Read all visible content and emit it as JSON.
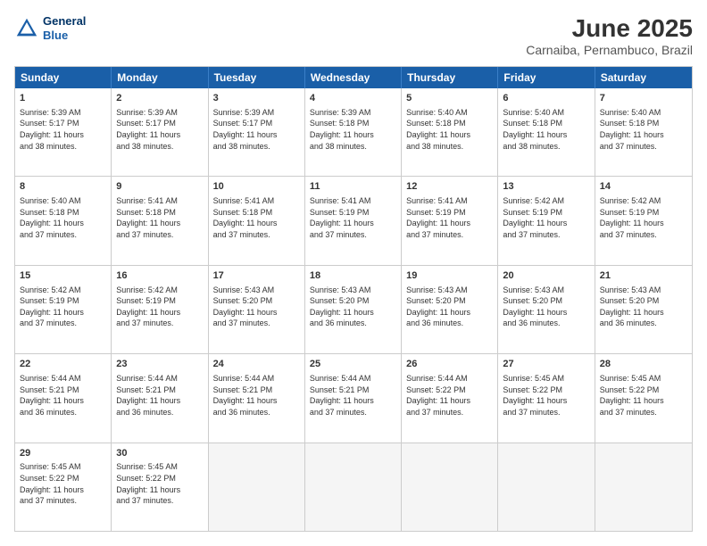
{
  "header": {
    "logo_line1": "General",
    "logo_line2": "Blue",
    "month_year": "June 2025",
    "location": "Carnaiba, Pernambuco, Brazil"
  },
  "days": [
    "Sunday",
    "Monday",
    "Tuesday",
    "Wednesday",
    "Thursday",
    "Friday",
    "Saturday"
  ],
  "rows": [
    [
      {
        "day": "",
        "info": ""
      },
      {
        "day": "2",
        "info": "Sunrise: 5:39 AM\nSunset: 5:17 PM\nDaylight: 11 hours\nand 38 minutes."
      },
      {
        "day": "3",
        "info": "Sunrise: 5:39 AM\nSunset: 5:17 PM\nDaylight: 11 hours\nand 38 minutes."
      },
      {
        "day": "4",
        "info": "Sunrise: 5:39 AM\nSunset: 5:18 PM\nDaylight: 11 hours\nand 38 minutes."
      },
      {
        "day": "5",
        "info": "Sunrise: 5:40 AM\nSunset: 5:18 PM\nDaylight: 11 hours\nand 38 minutes."
      },
      {
        "day": "6",
        "info": "Sunrise: 5:40 AM\nSunset: 5:18 PM\nDaylight: 11 hours\nand 38 minutes."
      },
      {
        "day": "7",
        "info": "Sunrise: 5:40 AM\nSunset: 5:18 PM\nDaylight: 11 hours\nand 37 minutes."
      }
    ],
    [
      {
        "day": "1",
        "info": "Sunrise: 5:39 AM\nSunset: 5:17 PM\nDaylight: 11 hours\nand 38 minutes."
      },
      {
        "day": "9",
        "info": "Sunrise: 5:41 AM\nSunset: 5:18 PM\nDaylight: 11 hours\nand 37 minutes."
      },
      {
        "day": "10",
        "info": "Sunrise: 5:41 AM\nSunset: 5:18 PM\nDaylight: 11 hours\nand 37 minutes."
      },
      {
        "day": "11",
        "info": "Sunrise: 5:41 AM\nSunset: 5:19 PM\nDaylight: 11 hours\nand 37 minutes."
      },
      {
        "day": "12",
        "info": "Sunrise: 5:41 AM\nSunset: 5:19 PM\nDaylight: 11 hours\nand 37 minutes."
      },
      {
        "day": "13",
        "info": "Sunrise: 5:42 AM\nSunset: 5:19 PM\nDaylight: 11 hours\nand 37 minutes."
      },
      {
        "day": "14",
        "info": "Sunrise: 5:42 AM\nSunset: 5:19 PM\nDaylight: 11 hours\nand 37 minutes."
      }
    ],
    [
      {
        "day": "8",
        "info": "Sunrise: 5:40 AM\nSunset: 5:18 PM\nDaylight: 11 hours\nand 37 minutes."
      },
      {
        "day": "16",
        "info": "Sunrise: 5:42 AM\nSunset: 5:19 PM\nDaylight: 11 hours\nand 37 minutes."
      },
      {
        "day": "17",
        "info": "Sunrise: 5:43 AM\nSunset: 5:20 PM\nDaylight: 11 hours\nand 37 minutes."
      },
      {
        "day": "18",
        "info": "Sunrise: 5:43 AM\nSunset: 5:20 PM\nDaylight: 11 hours\nand 36 minutes."
      },
      {
        "day": "19",
        "info": "Sunrise: 5:43 AM\nSunset: 5:20 PM\nDaylight: 11 hours\nand 36 minutes."
      },
      {
        "day": "20",
        "info": "Sunrise: 5:43 AM\nSunset: 5:20 PM\nDaylight: 11 hours\nand 36 minutes."
      },
      {
        "day": "21",
        "info": "Sunrise: 5:43 AM\nSunset: 5:20 PM\nDaylight: 11 hours\nand 36 minutes."
      }
    ],
    [
      {
        "day": "15",
        "info": "Sunrise: 5:42 AM\nSunset: 5:19 PM\nDaylight: 11 hours\nand 37 minutes."
      },
      {
        "day": "23",
        "info": "Sunrise: 5:44 AM\nSunset: 5:21 PM\nDaylight: 11 hours\nand 36 minutes."
      },
      {
        "day": "24",
        "info": "Sunrise: 5:44 AM\nSunset: 5:21 PM\nDaylight: 11 hours\nand 36 minutes."
      },
      {
        "day": "25",
        "info": "Sunrise: 5:44 AM\nSunset: 5:21 PM\nDaylight: 11 hours\nand 37 minutes."
      },
      {
        "day": "26",
        "info": "Sunrise: 5:44 AM\nSunset: 5:22 PM\nDaylight: 11 hours\nand 37 minutes."
      },
      {
        "day": "27",
        "info": "Sunrise: 5:45 AM\nSunset: 5:22 PM\nDaylight: 11 hours\nand 37 minutes."
      },
      {
        "day": "28",
        "info": "Sunrise: 5:45 AM\nSunset: 5:22 PM\nDaylight: 11 hours\nand 37 minutes."
      }
    ],
    [
      {
        "day": "22",
        "info": "Sunrise: 5:44 AM\nSunset: 5:21 PM\nDaylight: 11 hours\nand 36 minutes."
      },
      {
        "day": "30",
        "info": "Sunrise: 5:45 AM\nSunset: 5:22 PM\nDaylight: 11 hours\nand 37 minutes."
      },
      {
        "day": "",
        "info": ""
      },
      {
        "day": "",
        "info": ""
      },
      {
        "day": "",
        "info": ""
      },
      {
        "day": "",
        "info": ""
      },
      {
        "day": "",
        "info": ""
      }
    ],
    [
      {
        "day": "29",
        "info": "Sunrise: 5:45 AM\nSunset: 5:22 PM\nDaylight: 11 hours\nand 37 minutes."
      },
      {
        "day": "",
        "info": ""
      },
      {
        "day": "",
        "info": ""
      },
      {
        "day": "",
        "info": ""
      },
      {
        "day": "",
        "info": ""
      },
      {
        "day": "",
        "info": ""
      },
      {
        "day": "",
        "info": ""
      }
    ]
  ],
  "row_starts": [
    [
      null,
      2,
      3,
      4,
      5,
      6,
      7
    ],
    [
      1,
      9,
      10,
      11,
      12,
      13,
      14
    ],
    [
      8,
      16,
      17,
      18,
      19,
      20,
      21
    ],
    [
      15,
      23,
      24,
      25,
      26,
      27,
      28
    ],
    [
      22,
      30,
      null,
      null,
      null,
      null,
      null
    ],
    [
      29,
      null,
      null,
      null,
      null,
      null,
      null
    ]
  ]
}
